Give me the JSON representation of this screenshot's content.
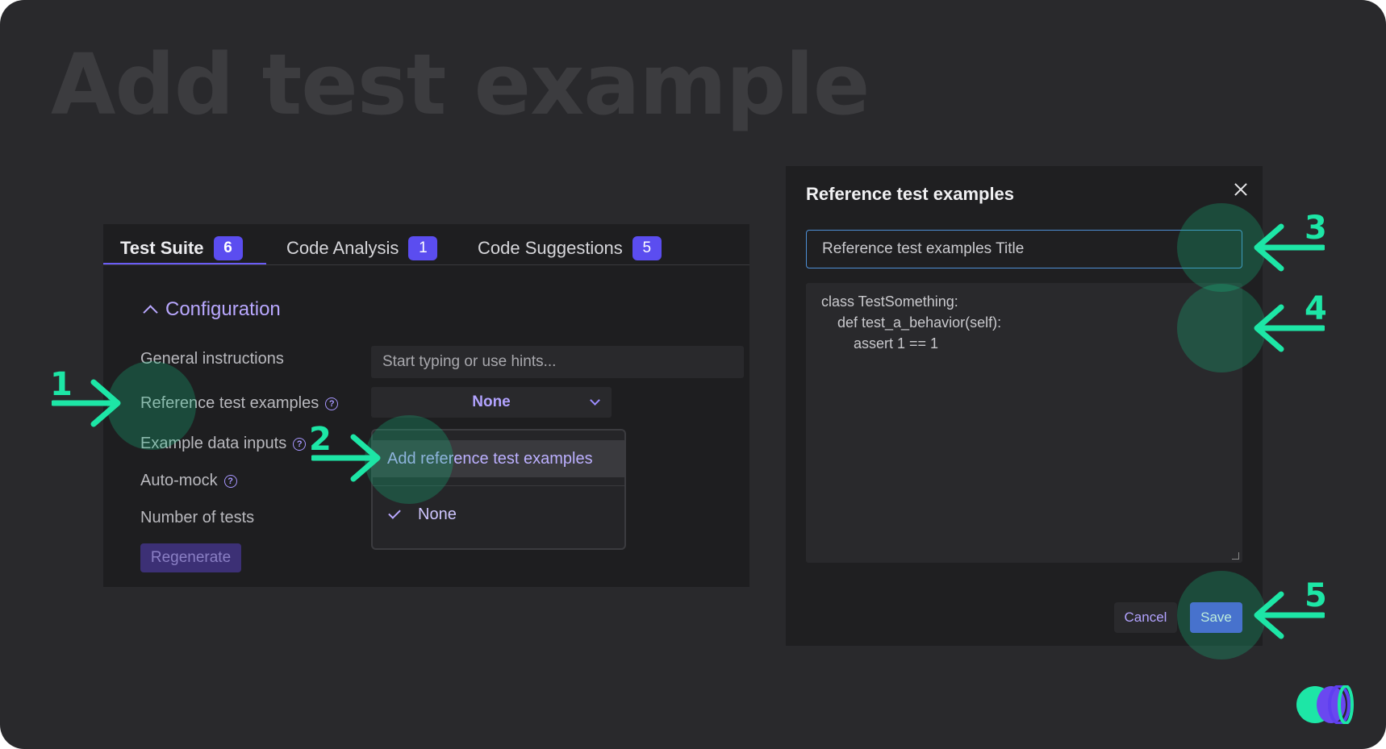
{
  "hero_title": "Add test example",
  "tabs": [
    {
      "label": "Test Suite",
      "count": "6"
    },
    {
      "label": "Code Analysis",
      "count": "1"
    },
    {
      "label": "Code Suggestions",
      "count": "5"
    }
  ],
  "configuration": {
    "title": "Configuration",
    "labels": {
      "general_instructions": "General instructions",
      "reference_test_examples": "Reference test examples",
      "example_data_inputs": "Example data inputs",
      "auto_mock": "Auto-mock",
      "number_of_tests": "Number of tests"
    },
    "general_instructions_placeholder": "Start typing or use hints...",
    "reference_select_value": "None",
    "dropdown": {
      "add_option": "Add reference test examples",
      "none_option": "None"
    },
    "regenerate_label": "Regenerate"
  },
  "modal": {
    "title": "Reference test examples",
    "title_input_value": "Reference test examples Title",
    "code_lines": [
      "class TestSomething:",
      "    def test_a_behavior(self):",
      "        assert 1 == 1"
    ],
    "cancel_label": "Cancel",
    "save_label": "Save"
  },
  "steps": [
    "1",
    "2",
    "3",
    "4",
    "5"
  ],
  "colors": {
    "accent": "#5b4df0",
    "annotation": "#1de6a6",
    "background": "#29292c"
  },
  "icons": [
    "chevron-up-icon",
    "help-icon",
    "chevron-down-icon",
    "check-icon",
    "close-icon",
    "arrow-icon",
    "brand-logo"
  ]
}
